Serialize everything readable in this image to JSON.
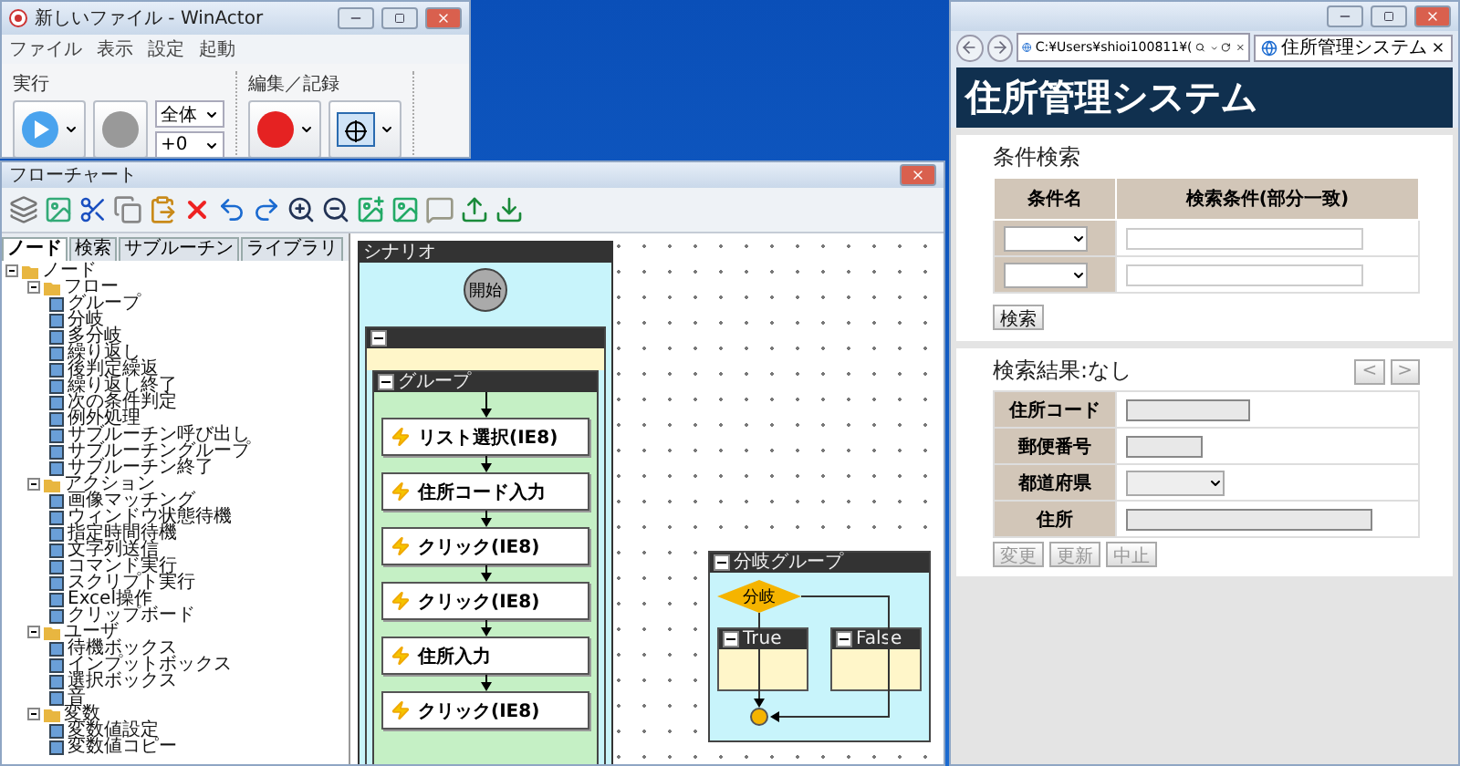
{
  "winactor": {
    "title": "新しいファイル - WinActor",
    "menu": [
      "ファイル",
      "表示",
      "設定",
      "起動"
    ],
    "run_group": "実行",
    "edit_group": "編集／記録",
    "scope_select": "全体",
    "offset_select": "+0"
  },
  "flowchart": {
    "title": "フローチャート",
    "tabs": [
      {
        "label": "ノード",
        "selected": true
      },
      {
        "label": "検索",
        "selected": false
      },
      {
        "label": "サブルーチン",
        "selected": false
      },
      {
        "label": "ライブラリ",
        "selected": false
      }
    ],
    "tree": [
      {
        "label": "ノード",
        "expanded": true,
        "children": [
          {
            "label": "フロー",
            "expanded": true,
            "children": [
              {
                "label": "グループ"
              },
              {
                "label": "分岐"
              },
              {
                "label": "多分岐"
              },
              {
                "label": "繰り返し"
              },
              {
                "label": "後判定繰返"
              },
              {
                "label": "繰り返し終了"
              },
              {
                "label": "次の条件判定"
              },
              {
                "label": "例外処理"
              },
              {
                "label": "サブルーチン呼び出し"
              },
              {
                "label": "サブルーチングループ"
              },
              {
                "label": "サブルーチン終了"
              }
            ]
          },
          {
            "label": "アクション",
            "expanded": true,
            "children": [
              {
                "label": "画像マッチング"
              },
              {
                "label": "ウィンドウ状態待機"
              },
              {
                "label": "指定時間待機"
              },
              {
                "label": "文字列送信"
              },
              {
                "label": "コマンド実行"
              },
              {
                "label": "スクリプト実行"
              },
              {
                "label": "Excel操作"
              },
              {
                "label": "クリップボード"
              }
            ]
          },
          {
            "label": "ユーザ",
            "expanded": true,
            "children": [
              {
                "label": "待機ボックス"
              },
              {
                "label": "インプットボックス"
              },
              {
                "label": "選択ボックス"
              },
              {
                "label": "音"
              }
            ]
          },
          {
            "label": "変数",
            "expanded": true,
            "children": [
              {
                "label": "変数値設定"
              },
              {
                "label": "変数値コピー"
              }
            ]
          }
        ]
      }
    ],
    "scenario": {
      "title": "シナリオ",
      "start": "開始",
      "group_title": "グループ",
      "actions": [
        "リスト選択(IE8)",
        "住所コード入力",
        "クリック(IE8)",
        "クリック(IE8)",
        "住所入力",
        "クリック(IE8)"
      ]
    },
    "branch_group": {
      "title": "分岐グループ",
      "condition": "分岐",
      "true_label": "True",
      "false_label": "False"
    }
  },
  "browser": {
    "address": "C:¥Users¥shioi100811¥(",
    "tab": "住所管理システム",
    "page_title": "住所管理システム",
    "search": {
      "title": "条件検索",
      "columns": [
        "条件名",
        "検索条件(部分一致)"
      ],
      "rows": [
        {
          "kind": "select"
        },
        {
          "kind": "select"
        }
      ],
      "button": "検索"
    },
    "results": {
      "title": "検索結果:なし",
      "prev": "<",
      "next": ">",
      "fields": [
        {
          "label": "住所コード",
          "kind": "text"
        },
        {
          "label": "郵便番号",
          "kind": "short"
        },
        {
          "label": "都道府県",
          "kind": "select"
        },
        {
          "label": "住所",
          "kind": "wide"
        }
      ],
      "actions": [
        {
          "label": "変更",
          "disabled": true
        },
        {
          "label": "更新",
          "disabled": true
        },
        {
          "label": "中止",
          "disabled": true
        }
      ]
    }
  }
}
